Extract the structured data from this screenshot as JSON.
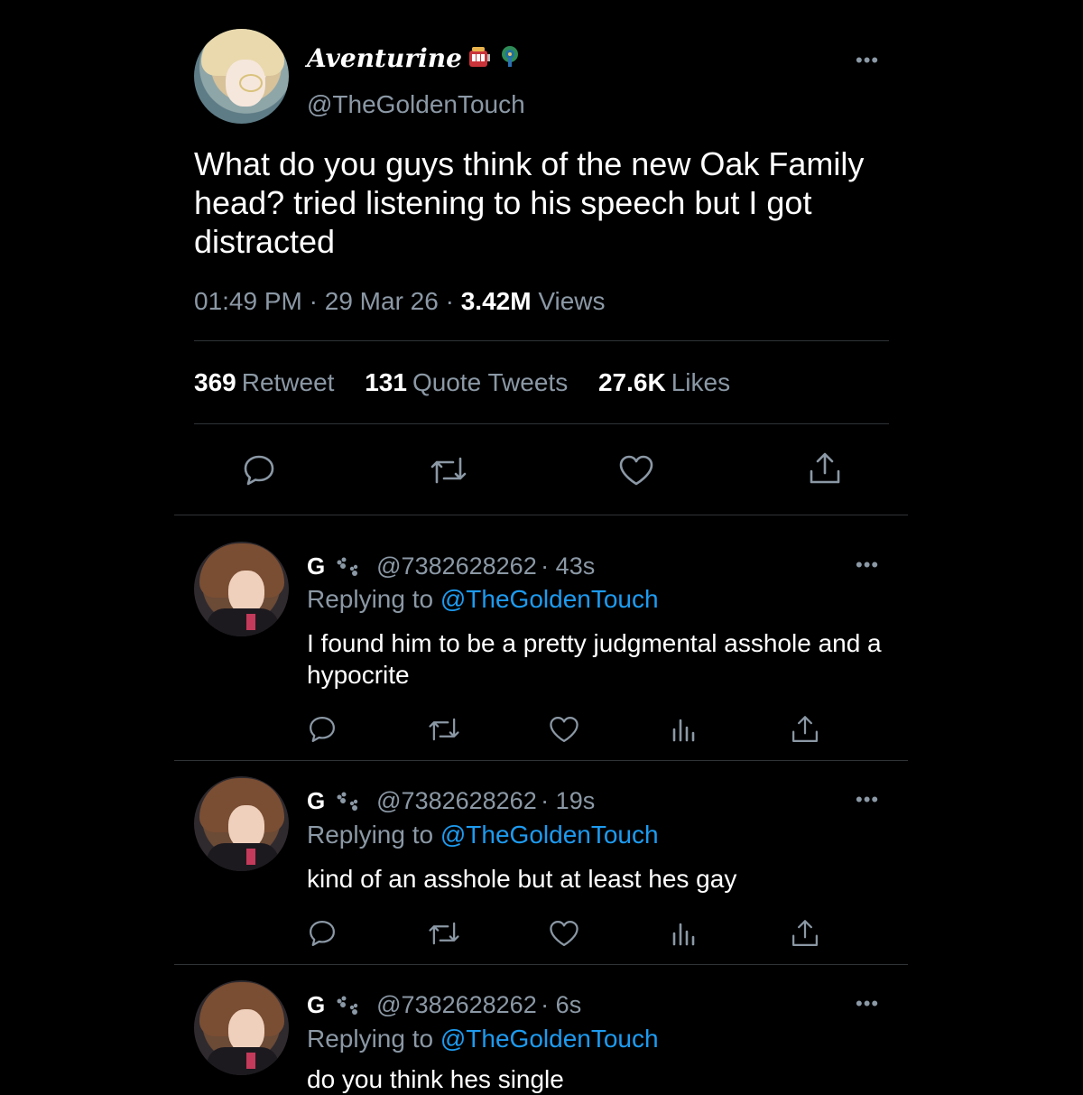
{
  "tweet": {
    "display_name": "Aventurine",
    "name_emojis": [
      "slot-machine-icon",
      "peacock-icon"
    ],
    "handle": "@TheGoldenTouch",
    "text": "What do you guys think of the new Oak Family head? tried listening to his speech but I got distracted",
    "time": "01:49 PM",
    "date": "29 Mar 26",
    "views_count": "3.42M",
    "views_label": "Views",
    "retweets_count": "369",
    "retweets_label": "Retweet",
    "quotes_count": "131",
    "quotes_label": "Quote Tweets",
    "likes_count": "27.6K",
    "likes_label": "Likes",
    "more_label": "•••"
  },
  "replies": [
    {
      "name": "G",
      "badge_icon": "paw-prints-icon",
      "handle": "@7382628262",
      "time": "43s",
      "replying_prefix": "Replying to",
      "replying_to": "@TheGoldenTouch",
      "text": "I found him to be a pretty judgmental asshole and a hypocrite",
      "more_label": "•••"
    },
    {
      "name": "G",
      "badge_icon": "paw-prints-icon",
      "handle": "@7382628262",
      "time": "19s",
      "replying_prefix": "Replying to",
      "replying_to": "@TheGoldenTouch",
      "text": "kind of an asshole but at least hes gay",
      "more_label": "•••"
    },
    {
      "name": "G",
      "badge_icon": "paw-prints-icon",
      "handle": "@7382628262",
      "time": "6s",
      "replying_prefix": "Replying to",
      "replying_to": "@TheGoldenTouch",
      "text": "do you think hes single",
      "more_label": "•••"
    }
  ],
  "colors": {
    "background": "#000000",
    "text": "#e7e9ea",
    "muted": "#8b98a5",
    "link": "#1d9bf0",
    "divider": "#2f3336"
  }
}
